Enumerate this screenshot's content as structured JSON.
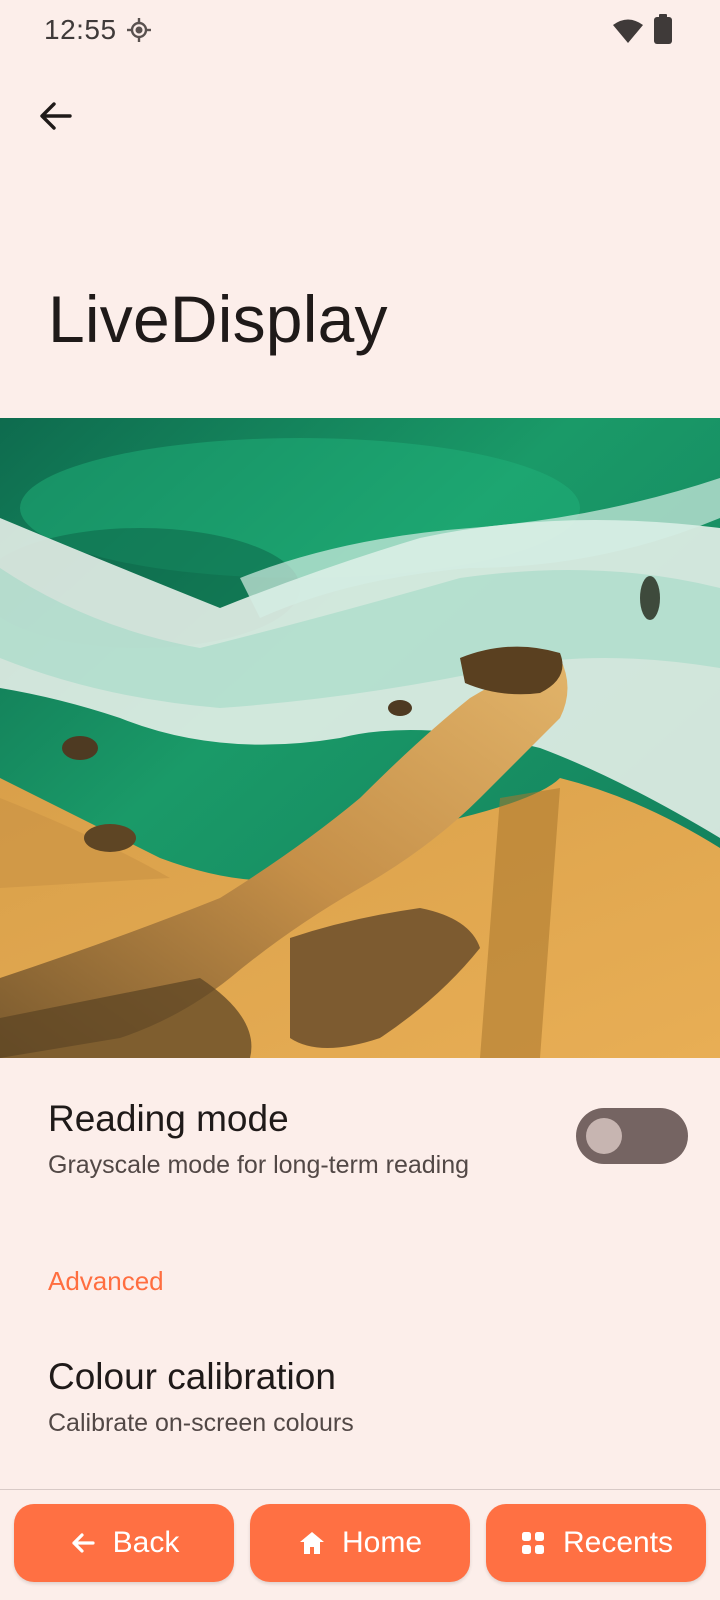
{
  "status_bar": {
    "time": "12:55",
    "icons": [
      "location-icon",
      "wifi-icon",
      "battery-icon"
    ]
  },
  "app_bar": {
    "back_icon": "arrow-back-icon"
  },
  "page": {
    "title": "LiveDisplay"
  },
  "preview": {
    "description_icon": "preview-image"
  },
  "reading_mode": {
    "title": "Reading mode",
    "summary": "Grayscale mode for long-term reading",
    "enabled": false
  },
  "advanced": {
    "header": "Advanced",
    "colour_calibration": {
      "title": "Colour calibration",
      "summary": "Calibrate on-screen colours"
    }
  },
  "bottom_nav": {
    "back": "Back",
    "home": "Home",
    "recents": "Recents"
  },
  "colors": {
    "background": "#FCEEEA",
    "accent": "#FF7043",
    "section_header": "#FF6E40",
    "toggle_track_off": "#756462"
  }
}
